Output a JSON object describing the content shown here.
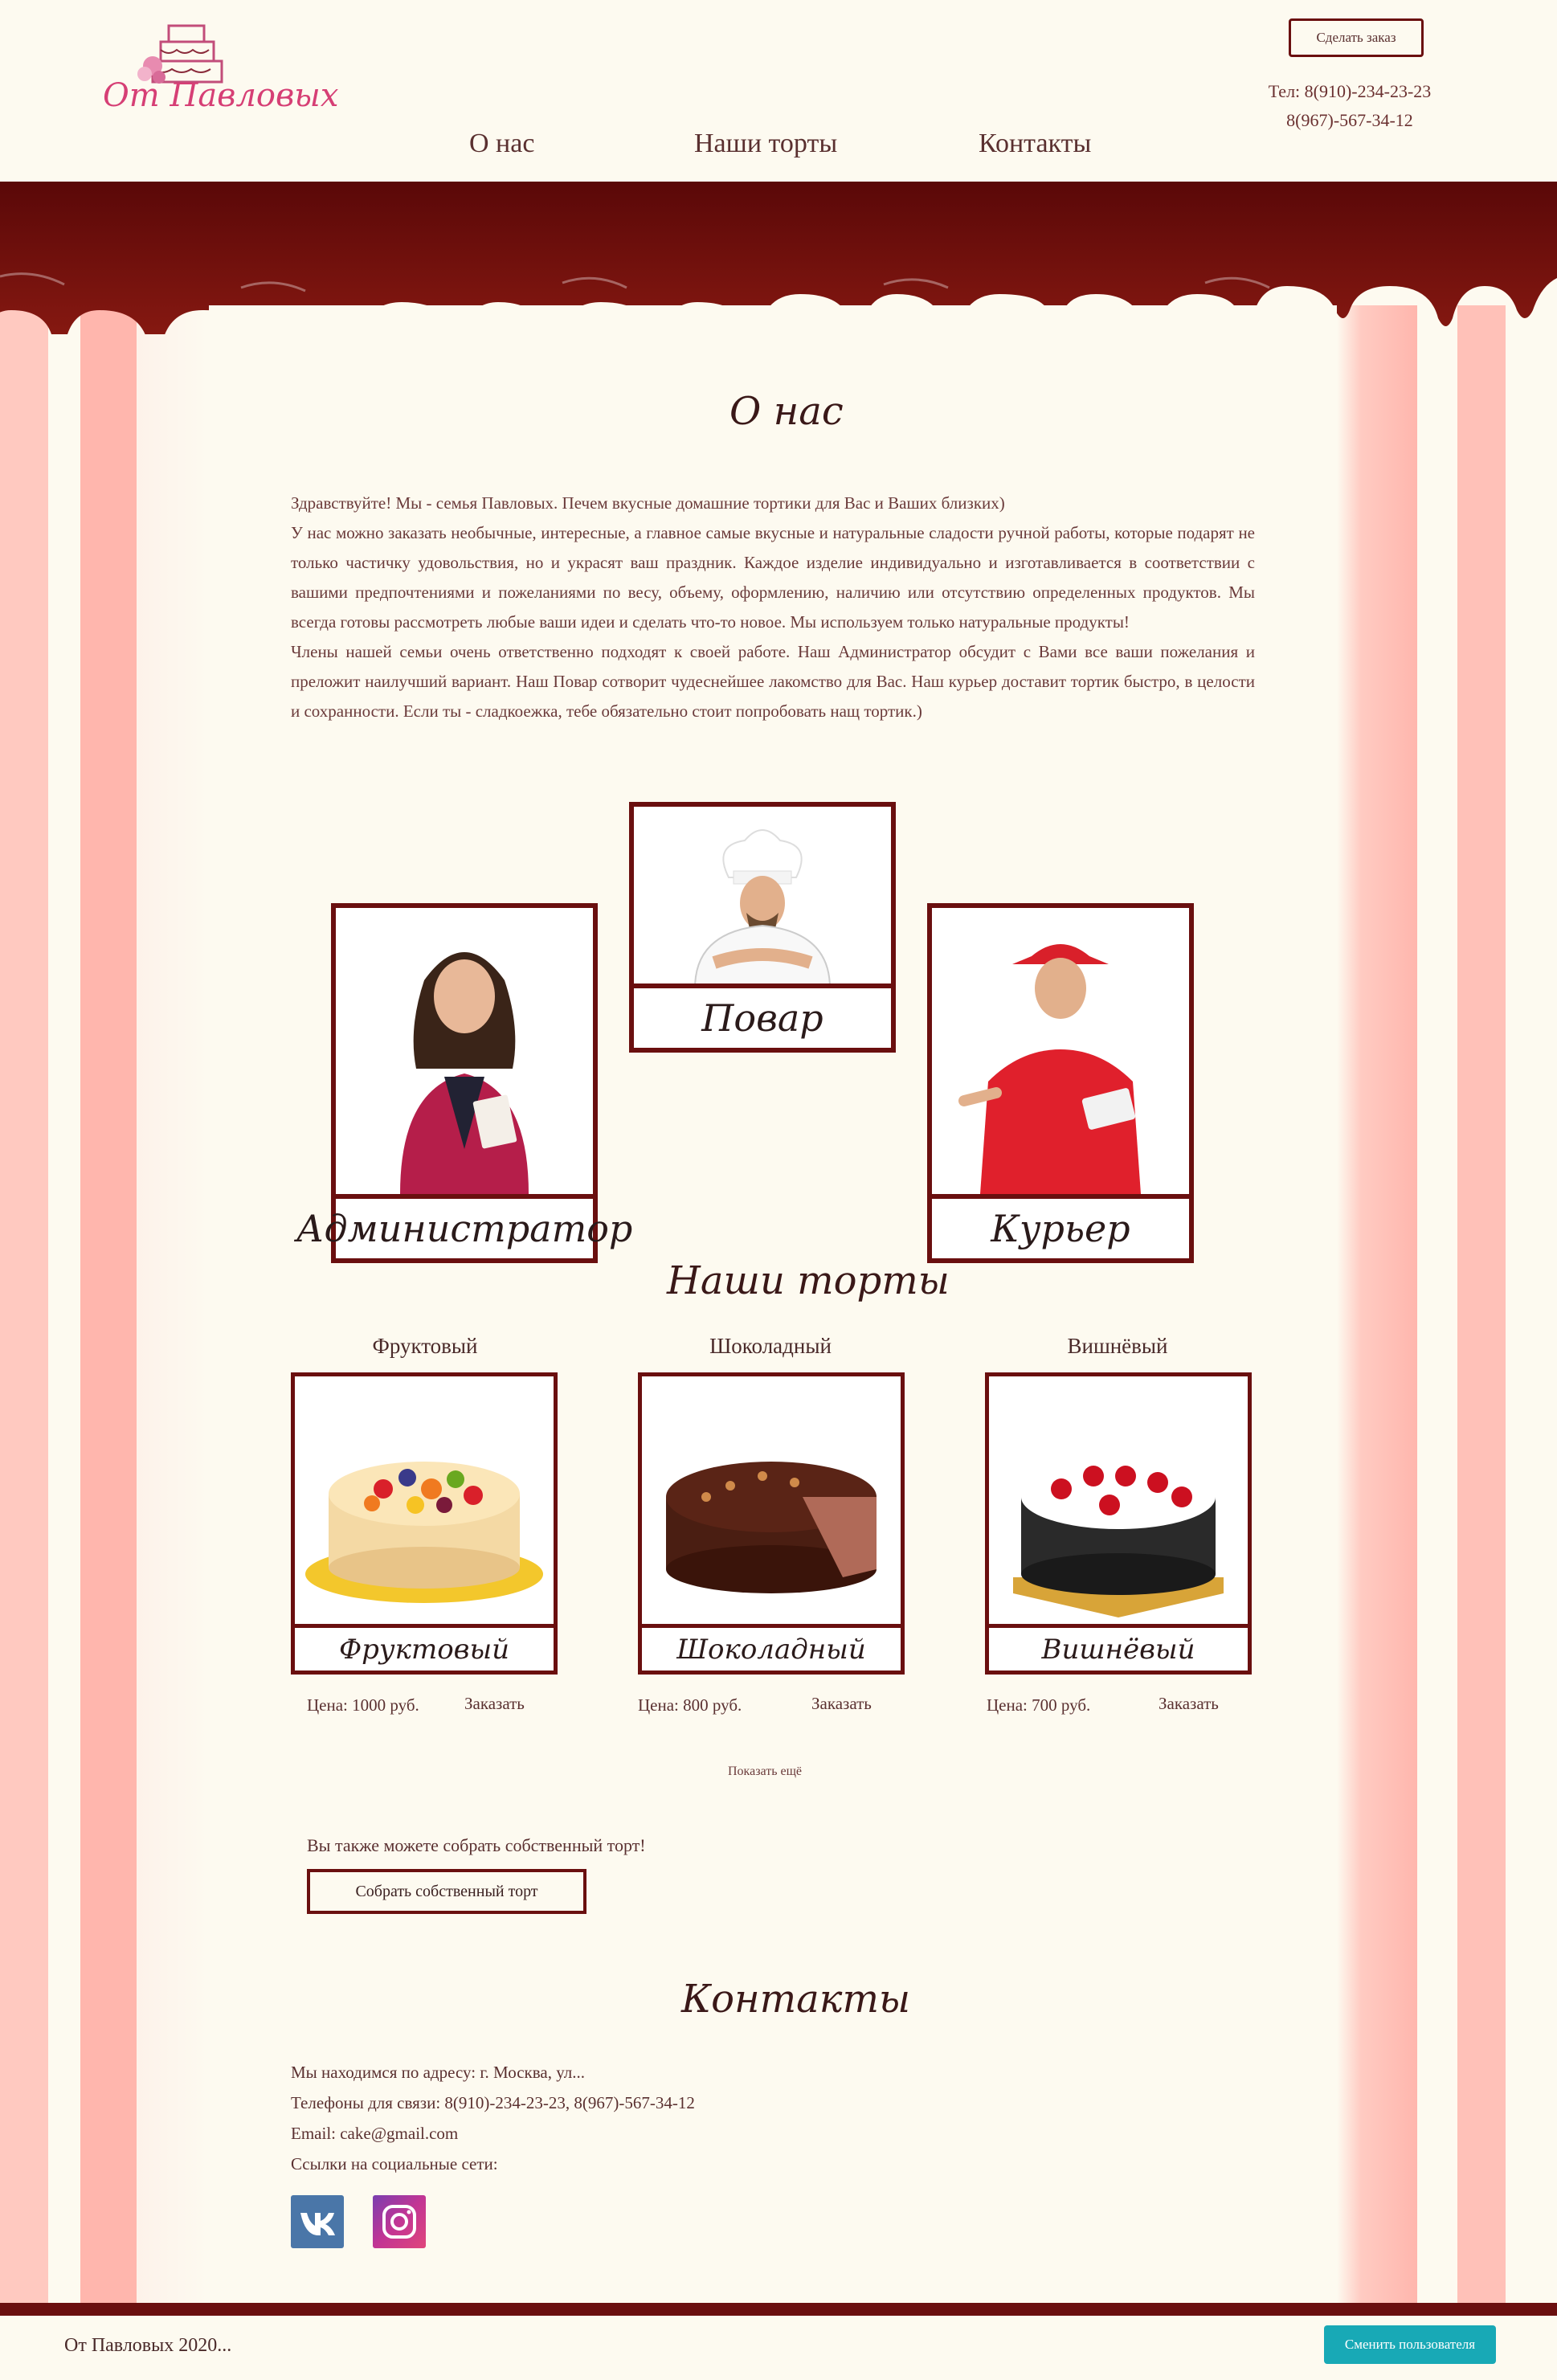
{
  "header": {
    "logo_text": "От Павловых",
    "order_button": "Сделать заказ",
    "phone_line_1": "Тел: 8(910)-234-23-23",
    "phone_line_2": "8(967)-567-34-12",
    "nav": [
      "О нас",
      "Наши торты",
      "Контакты"
    ]
  },
  "about": {
    "title": "О нас",
    "paragraphs": [
      "Здравствуйте! Мы - семья Павловых. Печем вкусные домашние тортики для Вас и Ваших близких)",
      "У нас можно заказать необычные, интересные, а главное самые вкусные и натуральные сладости ручной работы, которые подарят не только частичку удовольствия, но и украсят ваш праздник. Каждое изделие индивидуально и изготавливается в соответствии с вашими предпочтениями и пожеланиями по весу, объему, оформлению, наличию или отсутствию определенных продуктов. Мы всегда готовы рассмотреть любые ваши идеи и сделать что-то новое. Мы используем только натуральные продукты!",
      "Члены нашей семьи очень ответственно подходят к своей работе. Наш Администратор обсудит с Вами все ваши пожелания и преложит наилучший вариант. Наш Повар сотворит чудеснейшее лакомство для Вас. Наш курьер доставит тортик быстро, в целости и сохранности. Если ты - сладкоежка, тебе обязательно стоит попробовать нащ тортик.)"
    ]
  },
  "team": [
    {
      "label": "Администратор"
    },
    {
      "label": "Повар"
    },
    {
      "label": "Курьер"
    }
  ],
  "cakes": {
    "title": "Наши торты",
    "items": [
      {
        "name": "Фруктовый",
        "label": "Фруктовый",
        "price": "Цена: 1000 руб.",
        "order": "Заказать"
      },
      {
        "name": "Шоколадный",
        "label": "Шоколадный",
        "price": "Цена: 800 руб.",
        "order": "Заказать"
      },
      {
        "name": "Вишнёвый",
        "label": "Вишнёвый",
        "price": "Цена: 700 руб.",
        "order": "Заказать"
      }
    ],
    "show_more": "Показать ещё",
    "custom_note": "Вы также можете собрать собственный торт!",
    "custom_button": "Собрать собственный торт"
  },
  "contacts": {
    "title": "Контакты",
    "address": "Мы находимся по адресу: г. Москва, ул...",
    "phones": "Телефоны для связи: 8(910)-234-23-23, 8(967)-567-34-12",
    "email": "Email: cake@gmail.com",
    "social_label": "Ссылки на социальные сети:",
    "social": [
      "vk-icon",
      "instagram-icon"
    ]
  },
  "footer": {
    "copyright": "От Павловых 2020...",
    "switch_user": "Сменить пользователя"
  },
  "colors": {
    "accent": "#6a0f0f",
    "background": "#fdfaf0",
    "stripe_pink": "#ffc1b8",
    "button_teal": "#18a9b6"
  }
}
